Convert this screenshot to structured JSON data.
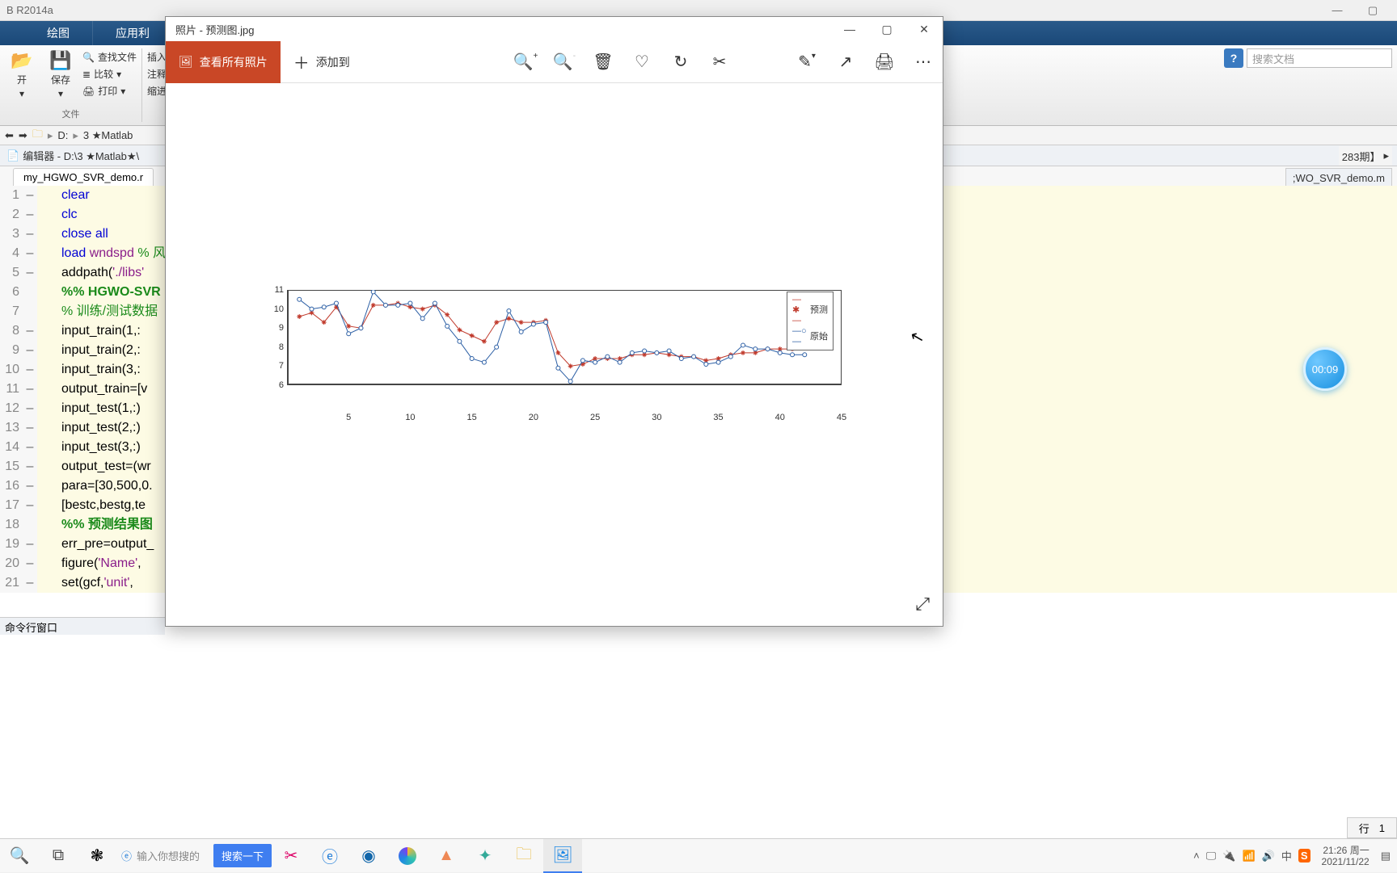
{
  "matlab": {
    "title": "B R2014a",
    "ribbon_tabs": {
      "t1": "绘图",
      "t2": "应用利"
    },
    "toolbar": {
      "open": "开",
      "save": "保存",
      "find": "查找文件",
      "compare": "比较",
      "print": "打印",
      "insert": "插入",
      "comment": "注释",
      "indent": "缩进",
      "group_file": "文件"
    },
    "search_placeholder": "搜索文档",
    "path": {
      "drive": "D:",
      "f1": "3 ★Matlab"
    },
    "right_path": "283期】",
    "right_file": ";WO_SVR_demo.m",
    "editor_title": "编辑器 - D:\\3 ★Matlab★\\",
    "tab_name": "my_HGWO_SVR_demo.r",
    "cmd_window": "命令行窗口",
    "status": {
      "line_label": "行",
      "line_val": "1"
    },
    "code": [
      {
        "n": "1",
        "bp": "–",
        "pre": "",
        "kw": "clear",
        "rest": ""
      },
      {
        "n": "2",
        "bp": "–",
        "pre": "",
        "kw": "clc",
        "rest": ""
      },
      {
        "n": "3",
        "bp": "–",
        "pre": "",
        "kw1": "close",
        "sp": " ",
        "kw2": "all",
        "rest": ""
      },
      {
        "n": "4",
        "bp": "–",
        "pre": "",
        "kw": "load",
        "sp": " ",
        "str": "wndspd",
        "rest": " ",
        "cm": "% 风"
      },
      {
        "n": "5",
        "bp": "–",
        "pre": "",
        "plain": "addpath(",
        "str": "'./libs'",
        "rest": ""
      },
      {
        "n": "6",
        "bp": "",
        "pre": "",
        "cmb": "%% HGWO-SVR"
      },
      {
        "n": "7",
        "bp": "",
        "pre": "",
        "cm": "% 训练/测试数据"
      },
      {
        "n": "8",
        "bp": "–",
        "pre": "",
        "plain": "input_train(1,:"
      },
      {
        "n": "9",
        "bp": "–",
        "pre": "",
        "plain": "input_train(2,:"
      },
      {
        "n": "10",
        "bp": "–",
        "pre": "",
        "plain": "input_train(3,:"
      },
      {
        "n": "11",
        "bp": "–",
        "pre": "",
        "plain": "output_train=[v"
      },
      {
        "n": "12",
        "bp": "–",
        "pre": "",
        "plain": "input_test(1,:)"
      },
      {
        "n": "13",
        "bp": "–",
        "pre": "",
        "plain": "input_test(2,:)"
      },
      {
        "n": "14",
        "bp": "–",
        "pre": "",
        "plain": "input_test(3,:)"
      },
      {
        "n": "15",
        "bp": "–",
        "pre": "",
        "plain": "output_test=(wr"
      },
      {
        "n": "16",
        "bp": "–",
        "pre": "",
        "plain": "para=[30,500,0."
      },
      {
        "n": "17",
        "bp": "–",
        "pre": "",
        "plain": "[bestc,bestg,te"
      },
      {
        "n": "18",
        "bp": "",
        "pre": "",
        "cmb": "%% 预测结果图"
      },
      {
        "n": "19",
        "bp": "–",
        "pre": "",
        "plain": "err_pre=output_"
      },
      {
        "n": "20",
        "bp": "–",
        "pre": "",
        "plain": "figure(",
        "str": "'Name'",
        "rest": ","
      },
      {
        "n": "21",
        "bp": "–",
        "pre": "",
        "plain": "set(gcf,",
        "str": "'unit'",
        "rest": ","
      }
    ]
  },
  "photos": {
    "title": "照片 - 预测图.jpg",
    "view_all": "查看所有照片",
    "add_to": "添加到"
  },
  "chart_data": {
    "type": "line",
    "xlim": [
      0,
      45
    ],
    "ylim": [
      6,
      11
    ],
    "x_ticks": [
      5,
      10,
      15,
      20,
      25,
      30,
      35,
      40,
      45
    ],
    "y_ticks": [
      6,
      7,
      8,
      9,
      10,
      11
    ],
    "legend": [
      "预测",
      "原始"
    ],
    "series": [
      {
        "name": "预测",
        "color": "#c0392b",
        "marker": "star",
        "x": [
          1,
          2,
          3,
          4,
          5,
          6,
          7,
          8,
          9,
          10,
          11,
          12,
          13,
          14,
          15,
          16,
          17,
          18,
          19,
          20,
          21,
          22,
          23,
          24,
          25,
          26,
          27,
          28,
          29,
          30,
          31,
          32,
          33,
          34,
          35,
          36,
          37,
          38,
          39,
          40,
          41,
          42
        ],
        "y": [
          9.6,
          9.8,
          9.3,
          10.1,
          9.1,
          9.0,
          10.2,
          10.2,
          10.3,
          10.1,
          10.0,
          10.2,
          9.7,
          8.9,
          8.6,
          8.3,
          9.3,
          9.5,
          9.3,
          9.3,
          9.4,
          7.7,
          7.0,
          7.1,
          7.4,
          7.4,
          7.4,
          7.6,
          7.6,
          7.7,
          7.6,
          7.5,
          7.5,
          7.3,
          7.4,
          7.6,
          7.7,
          7.7,
          7.9,
          7.9,
          7.9,
          8.0
        ]
      },
      {
        "name": "原始",
        "color": "#2c5fa5",
        "marker": "circle",
        "x": [
          1,
          2,
          3,
          4,
          5,
          6,
          7,
          8,
          9,
          10,
          11,
          12,
          13,
          14,
          15,
          16,
          17,
          18,
          19,
          20,
          21,
          22,
          23,
          24,
          25,
          26,
          27,
          28,
          29,
          30,
          31,
          32,
          33,
          34,
          35,
          36,
          37,
          38,
          39,
          40,
          41,
          42
        ],
        "y": [
          10.5,
          10.0,
          10.1,
          10.3,
          8.7,
          9.0,
          10.9,
          10.2,
          10.2,
          10.3,
          9.5,
          10.3,
          9.1,
          8.3,
          7.4,
          7.2,
          8.0,
          9.9,
          8.8,
          9.2,
          9.3,
          6.9,
          6.2,
          7.3,
          7.2,
          7.5,
          7.2,
          7.7,
          7.8,
          7.7,
          7.8,
          7.4,
          7.5,
          7.1,
          7.2,
          7.5,
          8.1,
          7.9,
          7.9,
          7.7,
          7.6,
          7.6
        ]
      }
    ]
  },
  "timer": "00:09",
  "taskbar": {
    "search_placeholder": "输入你想搜的",
    "search_btn": "搜索一下",
    "time": "21:26",
    "weekday": "周一",
    "date": "2021/11/22"
  }
}
